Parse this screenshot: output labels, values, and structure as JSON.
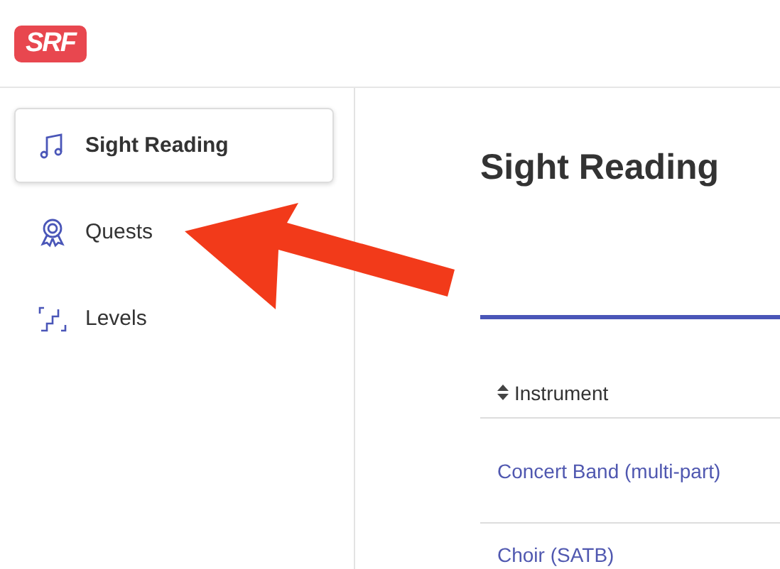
{
  "logo": {
    "text": "SRF"
  },
  "sidebar": {
    "items": [
      {
        "label": "Sight Reading",
        "selected": true
      },
      {
        "label": "Quests",
        "selected": false
      },
      {
        "label": "Levels",
        "selected": false
      }
    ]
  },
  "main": {
    "title": "Sight Reading",
    "table": {
      "columns": [
        {
          "label": "Instrument"
        }
      ],
      "rows": [
        {
          "instrument": "Concert Band (multi-part)"
        },
        {
          "instrument": "Choir (SATB)"
        }
      ]
    }
  }
}
